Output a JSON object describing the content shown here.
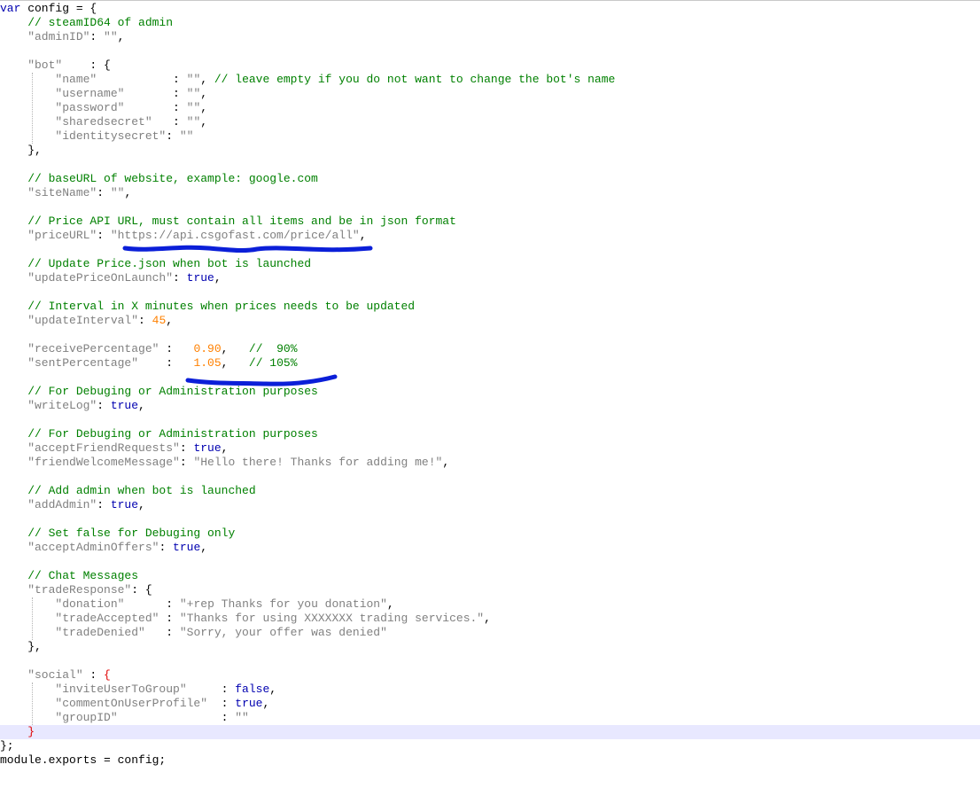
{
  "colors": {
    "keyword": "#0000b0",
    "punctuation": "#000000",
    "string": "#808080",
    "comment": "#008000",
    "number": "#ff8000",
    "brace_highlight": "#e00000",
    "current_line": "#e8e8ff",
    "annotation_ink": "#0b1fd8"
  },
  "code": {
    "lines": [
      {
        "hl": false,
        "tokens": [
          {
            "t": "k",
            "v": "var"
          },
          {
            "t": "p",
            "v": " config = {"
          }
        ]
      },
      {
        "hl": false,
        "tokens": [
          {
            "t": "c",
            "v": "    // steamID64 of admin"
          }
        ]
      },
      {
        "hl": false,
        "tokens": [
          {
            "t": "s",
            "v": "    \"adminID\""
          },
          {
            "t": "p",
            "v": ": "
          },
          {
            "t": "s",
            "v": "\"\""
          },
          {
            "t": "p",
            "v": ","
          }
        ]
      },
      {
        "hl": false,
        "tokens": []
      },
      {
        "hl": false,
        "tokens": [
          {
            "t": "s",
            "v": "    \"bot\""
          },
          {
            "t": "p",
            "v": "    : {"
          }
        ]
      },
      {
        "hl": false,
        "tokens": [
          {
            "t": "s",
            "v": "        \"name\""
          },
          {
            "t": "p",
            "v": "           : "
          },
          {
            "t": "s",
            "v": "\"\""
          },
          {
            "t": "p",
            "v": ", "
          },
          {
            "t": "c",
            "v": "// leave empty if you do not want to change the bot's name"
          }
        ]
      },
      {
        "hl": false,
        "tokens": [
          {
            "t": "s",
            "v": "        \"username\""
          },
          {
            "t": "p",
            "v": "       : "
          },
          {
            "t": "s",
            "v": "\"\""
          },
          {
            "t": "p",
            "v": ","
          }
        ]
      },
      {
        "hl": false,
        "tokens": [
          {
            "t": "s",
            "v": "        \"password\""
          },
          {
            "t": "p",
            "v": "       : "
          },
          {
            "t": "s",
            "v": "\"\""
          },
          {
            "t": "p",
            "v": ","
          }
        ]
      },
      {
        "hl": false,
        "tokens": [
          {
            "t": "s",
            "v": "        \"sharedsecret\""
          },
          {
            "t": "p",
            "v": "   : "
          },
          {
            "t": "s",
            "v": "\"\""
          },
          {
            "t": "p",
            "v": ","
          }
        ]
      },
      {
        "hl": false,
        "tokens": [
          {
            "t": "s",
            "v": "        \"identitysecret\""
          },
          {
            "t": "p",
            "v": ": "
          },
          {
            "t": "s",
            "v": "\"\""
          }
        ]
      },
      {
        "hl": false,
        "tokens": [
          {
            "t": "p",
            "v": "    },"
          }
        ]
      },
      {
        "hl": false,
        "tokens": []
      },
      {
        "hl": false,
        "tokens": [
          {
            "t": "c",
            "v": "    // baseURL of website, example: google.com"
          }
        ]
      },
      {
        "hl": false,
        "tokens": [
          {
            "t": "s",
            "v": "    \"siteName\""
          },
          {
            "t": "p",
            "v": ": "
          },
          {
            "t": "s",
            "v": "\"\""
          },
          {
            "t": "p",
            "v": ","
          }
        ]
      },
      {
        "hl": false,
        "tokens": []
      },
      {
        "hl": false,
        "tokens": [
          {
            "t": "c",
            "v": "    // Price API URL, must contain all items and be in json format"
          }
        ]
      },
      {
        "hl": false,
        "tokens": [
          {
            "t": "s",
            "v": "    \"priceURL\""
          },
          {
            "t": "p",
            "v": ": "
          },
          {
            "t": "s",
            "v": "\"https://api.csgofast.com/price/all\""
          },
          {
            "t": "p",
            "v": ","
          }
        ]
      },
      {
        "hl": false,
        "tokens": []
      },
      {
        "hl": false,
        "tokens": [
          {
            "t": "c",
            "v": "    // Update Price.json when bot is launched"
          }
        ]
      },
      {
        "hl": false,
        "tokens": [
          {
            "t": "s",
            "v": "    \"updatePriceOnLaunch\""
          },
          {
            "t": "p",
            "v": ": "
          },
          {
            "t": "k",
            "v": "true"
          },
          {
            "t": "p",
            "v": ","
          }
        ]
      },
      {
        "hl": false,
        "tokens": []
      },
      {
        "hl": false,
        "tokens": [
          {
            "t": "c",
            "v": "    // Interval in X minutes when prices needs to be updated"
          }
        ]
      },
      {
        "hl": false,
        "tokens": [
          {
            "t": "s",
            "v": "    \"updateInterval\""
          },
          {
            "t": "p",
            "v": ": "
          },
          {
            "t": "n",
            "v": "45"
          },
          {
            "t": "p",
            "v": ","
          }
        ]
      },
      {
        "hl": false,
        "tokens": []
      },
      {
        "hl": false,
        "tokens": [
          {
            "t": "s",
            "v": "    \"receivePercentage\""
          },
          {
            "t": "p",
            "v": " :   "
          },
          {
            "t": "n",
            "v": "0.90"
          },
          {
            "t": "p",
            "v": ",   "
          },
          {
            "t": "c",
            "v": "//  90%"
          }
        ]
      },
      {
        "hl": false,
        "tokens": [
          {
            "t": "s",
            "v": "    \"sentPercentage\""
          },
          {
            "t": "p",
            "v": "    :   "
          },
          {
            "t": "n",
            "v": "1.05"
          },
          {
            "t": "p",
            "v": ",   "
          },
          {
            "t": "c",
            "v": "// 105%"
          }
        ]
      },
      {
        "hl": false,
        "tokens": []
      },
      {
        "hl": false,
        "tokens": [
          {
            "t": "c",
            "v": "    // For Debuging or Administration purposes"
          }
        ]
      },
      {
        "hl": false,
        "tokens": [
          {
            "t": "s",
            "v": "    \"writeLog\""
          },
          {
            "t": "p",
            "v": ": "
          },
          {
            "t": "k",
            "v": "true"
          },
          {
            "t": "p",
            "v": ","
          }
        ]
      },
      {
        "hl": false,
        "tokens": []
      },
      {
        "hl": false,
        "tokens": [
          {
            "t": "c",
            "v": "    // For Debuging or Administration purposes"
          }
        ]
      },
      {
        "hl": false,
        "tokens": [
          {
            "t": "s",
            "v": "    \"acceptFriendRequests\""
          },
          {
            "t": "p",
            "v": ": "
          },
          {
            "t": "k",
            "v": "true"
          },
          {
            "t": "p",
            "v": ","
          }
        ]
      },
      {
        "hl": false,
        "tokens": [
          {
            "t": "s",
            "v": "    \"friendWelcomeMessage\""
          },
          {
            "t": "p",
            "v": ": "
          },
          {
            "t": "s",
            "v": "\"Hello there! Thanks for adding me!\""
          },
          {
            "t": "p",
            "v": ","
          }
        ]
      },
      {
        "hl": false,
        "tokens": []
      },
      {
        "hl": false,
        "tokens": [
          {
            "t": "c",
            "v": "    // Add admin when bot is launched"
          }
        ]
      },
      {
        "hl": false,
        "tokens": [
          {
            "t": "s",
            "v": "    \"addAdmin\""
          },
          {
            "t": "p",
            "v": ": "
          },
          {
            "t": "k",
            "v": "true"
          },
          {
            "t": "p",
            "v": ","
          }
        ]
      },
      {
        "hl": false,
        "tokens": []
      },
      {
        "hl": false,
        "tokens": [
          {
            "t": "c",
            "v": "    // Set false for Debuging only"
          }
        ]
      },
      {
        "hl": false,
        "tokens": [
          {
            "t": "s",
            "v": "    \"acceptAdminOffers\""
          },
          {
            "t": "p",
            "v": ": "
          },
          {
            "t": "k",
            "v": "true"
          },
          {
            "t": "p",
            "v": ","
          }
        ]
      },
      {
        "hl": false,
        "tokens": []
      },
      {
        "hl": false,
        "tokens": [
          {
            "t": "c",
            "v": "    // Chat Messages"
          }
        ]
      },
      {
        "hl": false,
        "tokens": [
          {
            "t": "s",
            "v": "    \"tradeResponse\""
          },
          {
            "t": "p",
            "v": ": {"
          }
        ]
      },
      {
        "hl": false,
        "tokens": [
          {
            "t": "s",
            "v": "        \"donation\""
          },
          {
            "t": "p",
            "v": "      : "
          },
          {
            "t": "s",
            "v": "\"+rep Thanks for you donation\""
          },
          {
            "t": "p",
            "v": ","
          }
        ]
      },
      {
        "hl": false,
        "tokens": [
          {
            "t": "s",
            "v": "        \"tradeAccepted\""
          },
          {
            "t": "p",
            "v": " : "
          },
          {
            "t": "s",
            "v": "\"Thanks for using XXXXXXX trading services.\""
          },
          {
            "t": "p",
            "v": ","
          }
        ]
      },
      {
        "hl": false,
        "tokens": [
          {
            "t": "s",
            "v": "        \"tradeDenied\""
          },
          {
            "t": "p",
            "v": "   : "
          },
          {
            "t": "s",
            "v": "\"Sorry, your offer was denied\""
          }
        ]
      },
      {
        "hl": false,
        "tokens": [
          {
            "t": "p",
            "v": "    },"
          }
        ]
      },
      {
        "hl": false,
        "tokens": []
      },
      {
        "hl": false,
        "tokens": [
          {
            "t": "s",
            "v": "    \"social\""
          },
          {
            "t": "p",
            "v": " : "
          },
          {
            "t": "b",
            "v": "{"
          }
        ]
      },
      {
        "hl": false,
        "tokens": [
          {
            "t": "s",
            "v": "        \"inviteUserToGroup\""
          },
          {
            "t": "p",
            "v": "     : "
          },
          {
            "t": "k",
            "v": "false"
          },
          {
            "t": "p",
            "v": ","
          }
        ]
      },
      {
        "hl": false,
        "tokens": [
          {
            "t": "s",
            "v": "        \"commentOnUserProfile\""
          },
          {
            "t": "p",
            "v": "  : "
          },
          {
            "t": "k",
            "v": "true"
          },
          {
            "t": "p",
            "v": ","
          }
        ]
      },
      {
        "hl": false,
        "tokens": [
          {
            "t": "s",
            "v": "        \"groupID\""
          },
          {
            "t": "p",
            "v": "               : "
          },
          {
            "t": "s",
            "v": "\"\""
          }
        ]
      },
      {
        "hl": true,
        "tokens": [
          {
            "t": "b",
            "v": "    }"
          }
        ]
      },
      {
        "hl": false,
        "tokens": [
          {
            "t": "p",
            "v": "};"
          }
        ]
      },
      {
        "hl": false,
        "tokens": [
          {
            "t": "p",
            "v": "module.exports = config;"
          }
        ]
      }
    ]
  }
}
